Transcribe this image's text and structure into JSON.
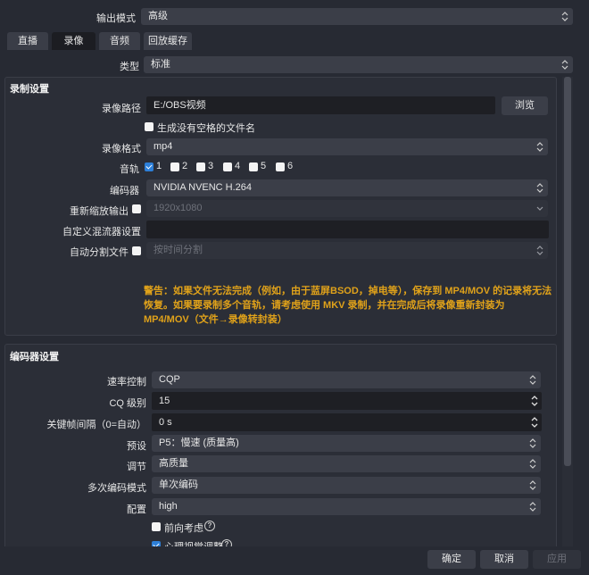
{
  "output_mode": {
    "label": "输出模式",
    "value": "高级"
  },
  "tabs": [
    {
      "label": "直播"
    },
    {
      "label": "录像"
    },
    {
      "label": "音频"
    },
    {
      "label": "回放缓存"
    }
  ],
  "type": {
    "label": "类型",
    "value": "标准"
  },
  "recording_settings": {
    "title": "录制设置",
    "path_label": "录像路径",
    "path_value": "E:/OBS视频",
    "browse_button": "浏览",
    "no_space_filename": "生成没有空格的文件名",
    "format_label": "录像格式",
    "format_value": "mp4",
    "audio_track_label": "音轨",
    "tracks": [
      {
        "label": "1",
        "checked": true
      },
      {
        "label": "2",
        "checked": false
      },
      {
        "label": "3",
        "checked": false
      },
      {
        "label": "4",
        "checked": false
      },
      {
        "label": "5",
        "checked": false
      },
      {
        "label": "6",
        "checked": false
      }
    ],
    "encoder_label": "编码器",
    "encoder_value": "NVIDIA NVENC H.264",
    "rescale_label": "重新缩放输出",
    "rescale_value": "1920x1080",
    "muxer_label": "自定义混流器设置",
    "muxer_value": "",
    "split_label": "自动分割文件",
    "split_value": "按时间分割",
    "warning": "警告：如果文件无法完成（例如，由于蓝屏BSOD，掉电等），保存到 MP4/MOV 的记录将无法恢复。如果要录制多个音轨，请考虑使用 MKV 录制，并在完成后将录像重新封装为 MP4/MOV（文件→录像转封装）"
  },
  "encoder_settings": {
    "title": "编码器设置",
    "rate_control_label": "速率控制",
    "rate_control_value": "CQP",
    "cq_label": "CQ 级别",
    "cq_value": "15",
    "keyframe_label": "关键帧间隔（0=自动）",
    "keyframe_value": "0 s",
    "preset_label": "预设",
    "preset_value": "P5：慢速 (质量高)",
    "tuning_label": "调节",
    "tuning_value": "高质量",
    "multipass_label": "多次编码模式",
    "multipass_value": "单次编码",
    "profile_label": "配置",
    "profile_value": "high",
    "lookahead_label": "前向考虑",
    "psycho_label": "心理视觉调整"
  },
  "buttons": {
    "ok": "确定",
    "cancel": "取消",
    "apply": "应用"
  },
  "colors": {
    "accent": "#2d7fd8",
    "warning": "#e0a21a",
    "background": "#272a33"
  }
}
